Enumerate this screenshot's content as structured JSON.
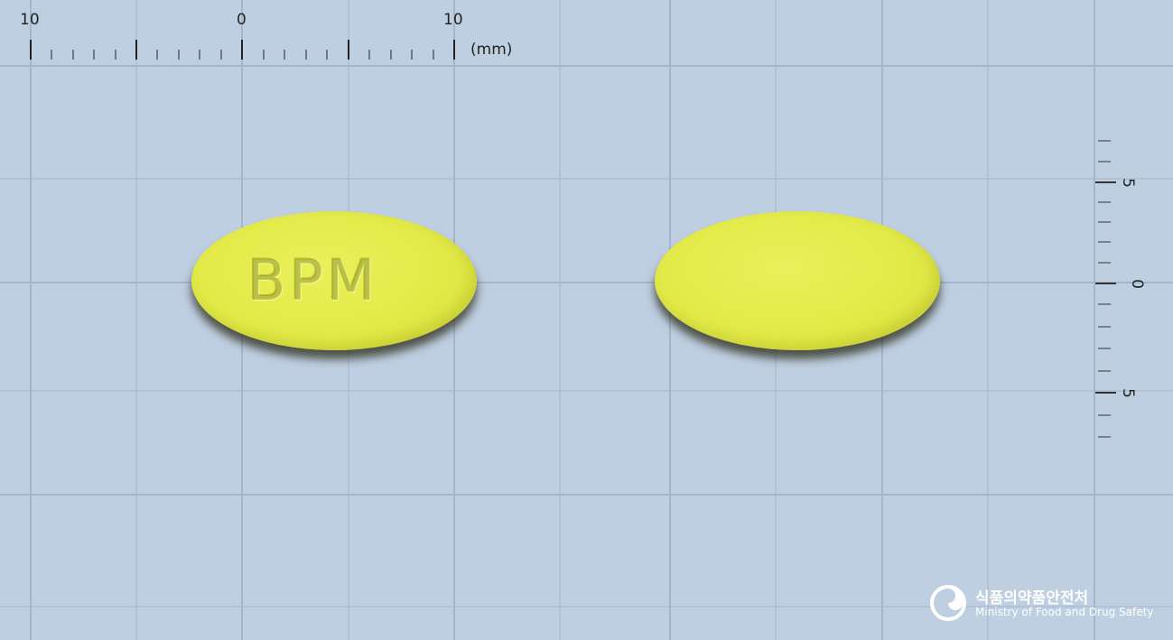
{
  "ruler": {
    "top_labels": [
      "10",
      "0",
      "10"
    ],
    "unit": "(mm)",
    "right_labels": [
      "5",
      "0",
      "5"
    ]
  },
  "tablets": [
    {
      "side": "front",
      "imprint": "BPM",
      "color": "#e1e84a"
    },
    {
      "side": "back",
      "imprint": "",
      "color": "#e1e84a"
    }
  ],
  "logo": {
    "icon": "mfds-emblem-icon",
    "korean": "식품의약품안전처",
    "english": "Ministry of Food and Drug Safety"
  },
  "colors": {
    "background": "#bfcfe2",
    "grid": "#a5b5c9"
  }
}
